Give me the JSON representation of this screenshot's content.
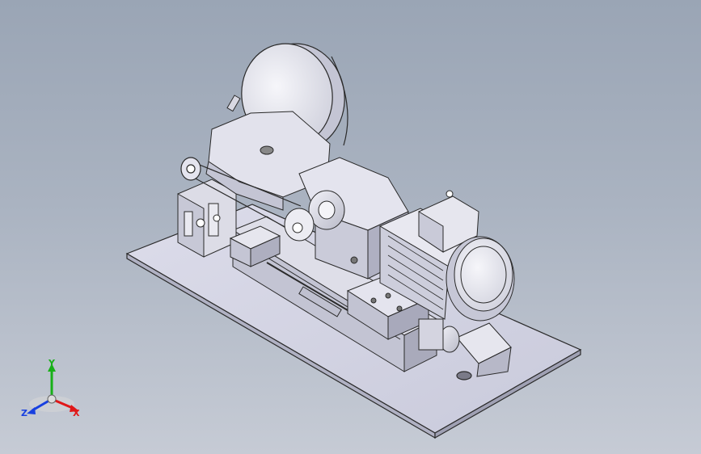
{
  "viewport": {
    "background_top": "#9aa5b5",
    "background_bottom": "#c6cbd5",
    "model_fill": "#e6e6ee",
    "edge_color": "#2a2a2a"
  },
  "triad": {
    "x_label": "X",
    "y_label": "Y",
    "z_label": "Z",
    "x_color": "#e01818",
    "y_color": "#18b018",
    "z_color": "#1840e0"
  }
}
